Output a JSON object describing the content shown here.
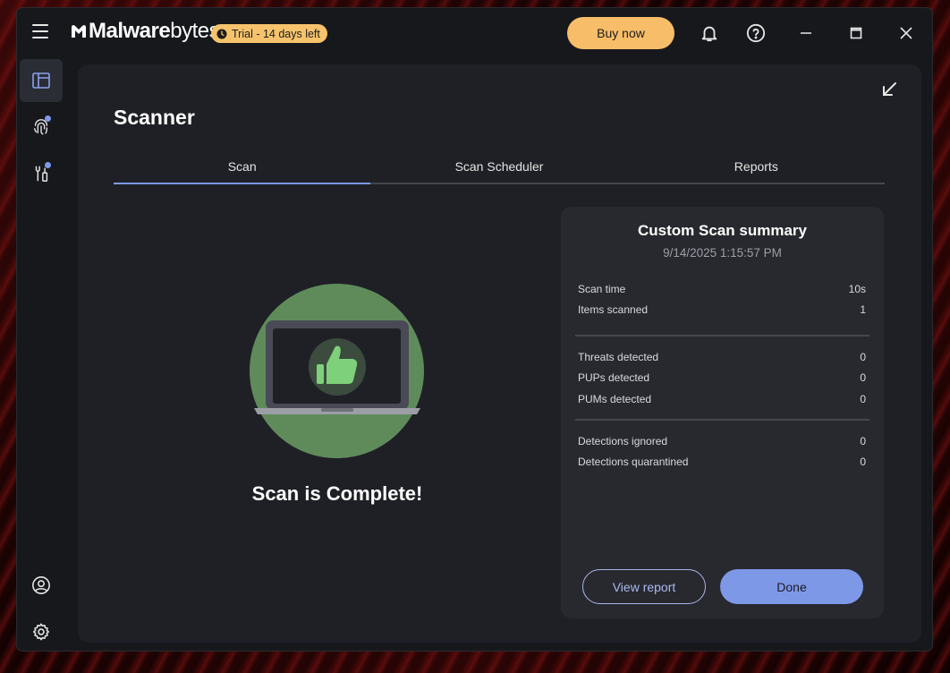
{
  "app": {
    "brand_bold": "Malware",
    "brand_regular": "bytes",
    "trial_badge": "Trial - 14 days left",
    "buy_label": "Buy now"
  },
  "page": {
    "title": "Scanner",
    "tabs": [
      {
        "label": "Scan",
        "active": true
      },
      {
        "label": "Scan Scheduler",
        "active": false
      },
      {
        "label": "Reports",
        "active": false
      }
    ],
    "complete_text": "Scan is Complete!"
  },
  "summary": {
    "title": "Custom Scan summary",
    "date": "9/14/2025 1:15:57 PM",
    "group1": [
      {
        "label": "Scan time",
        "value": "10s"
      },
      {
        "label": "Items scanned",
        "value": "1"
      }
    ],
    "group2": [
      {
        "label": "Threats detected",
        "value": "0"
      },
      {
        "label": "PUPs detected",
        "value": "0"
      },
      {
        "label": "PUMs detected",
        "value": "0"
      }
    ],
    "group3": [
      {
        "label": "Detections ignored",
        "value": "0"
      },
      {
        "label": "Detections quarantined",
        "value": "0"
      }
    ],
    "view_report_label": "View report",
    "done_label": "Done"
  },
  "icons": {
    "menu": "hamburger-icon",
    "bell": "bell-icon",
    "help": "help-icon",
    "minimize": "minimize-icon",
    "maximize": "maximize-icon",
    "close": "close-icon",
    "dashboard": "dashboard-icon",
    "fingerprint": "fingerprint-icon",
    "tools": "tools-icon",
    "account": "account-icon",
    "settings": "gear-icon",
    "collapse": "collapse-arrow-icon"
  },
  "colors": {
    "accent": "#7e98ec",
    "buy": "#f8bd68",
    "badge": "#f6c36c",
    "success": "#5f8b5b",
    "thumb": "#7ed07a"
  }
}
